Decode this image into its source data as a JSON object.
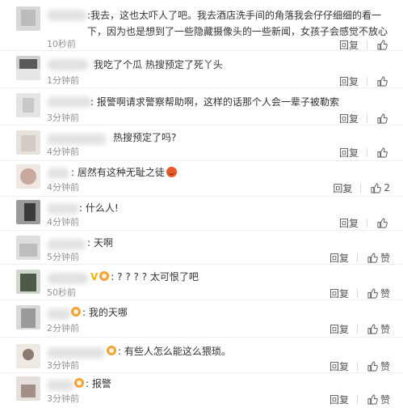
{
  "actions": {
    "reply_label": "回复",
    "like_label": "赞"
  },
  "comments": [
    {
      "text": "我去，这也太吓人了吧。我去酒店洗手间的角落我会仔仔细细的看一下，因为也是想到了一些隐藏摄像头的一些新闻，女孩子会感觉不放心",
      "time": "10秒前",
      "likes": "",
      "show_like_label": false
    },
    {
      "text": "我吃了个瓜 热搜预定了死丫头",
      "time": "1分钟前",
      "likes": "",
      "show_like_label": false
    },
    {
      "text": "报警啊请求警察帮助啊，这样的话那个人会一辈子被勒索",
      "time": "3分钟前",
      "likes": "",
      "show_like_label": false
    },
    {
      "text": "热搜预定了吗?",
      "time": "4分钟前",
      "likes": "",
      "show_like_label": false
    },
    {
      "text": "居然有这种无耻之徒",
      "time": "4分钟前",
      "likes": "2",
      "show_like_label": false
    },
    {
      "text": "什么人!",
      "time": "4分钟前",
      "likes": "",
      "show_like_label": false
    },
    {
      "text": "天啊",
      "time": "5分钟前",
      "likes": "",
      "show_like_label": true
    },
    {
      "text": "? ? ? ? 太可恨了吧",
      "time": "50秒前",
      "likes": "",
      "show_like_label": true
    },
    {
      "text": "我的天哪",
      "time": "2分钟前",
      "likes": "",
      "show_like_label": true
    },
    {
      "text": "有些人怎么能这么猥琐。",
      "time": "3分钟前",
      "likes": "",
      "show_like_label": true
    },
    {
      "text": "报警",
      "time": "3分钟前",
      "likes": "",
      "show_like_label": true
    }
  ]
}
